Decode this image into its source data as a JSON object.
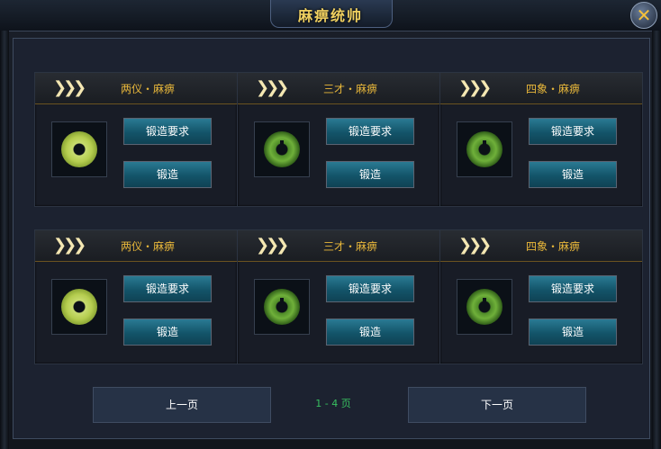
{
  "window": {
    "title": "麻痹统帅",
    "close_icon": "✕"
  },
  "cards": [
    {
      "title": "两仪・麻痹",
      "jade": "pale",
      "req_label": "锻造要求",
      "forge_label": "锻造"
    },
    {
      "title": "三才・麻痹",
      "jade": "dark",
      "req_label": "锻造要求",
      "forge_label": "锻造"
    },
    {
      "title": "四象・麻痹",
      "jade": "dark",
      "req_label": "锻造要求",
      "forge_label": "锻造"
    },
    {
      "title": "两仪・麻痹",
      "jade": "pale",
      "req_label": "锻造要求",
      "forge_label": "锻造"
    },
    {
      "title": "三才・麻痹",
      "jade": "dark",
      "req_label": "锻造要求",
      "forge_label": "锻造"
    },
    {
      "title": "四象・麻痹",
      "jade": "dark",
      "req_label": "锻造要求",
      "forge_label": "锻造"
    }
  ],
  "header_arrows": "❯❯❯",
  "pager": {
    "prev_label": "上一页",
    "next_label": "下一页",
    "page_text": "1 - 4 页"
  },
  "colors": {
    "title": "#f0d060",
    "card_title": "#e8b73a",
    "button": "#135469",
    "page_text": "#38c060"
  }
}
